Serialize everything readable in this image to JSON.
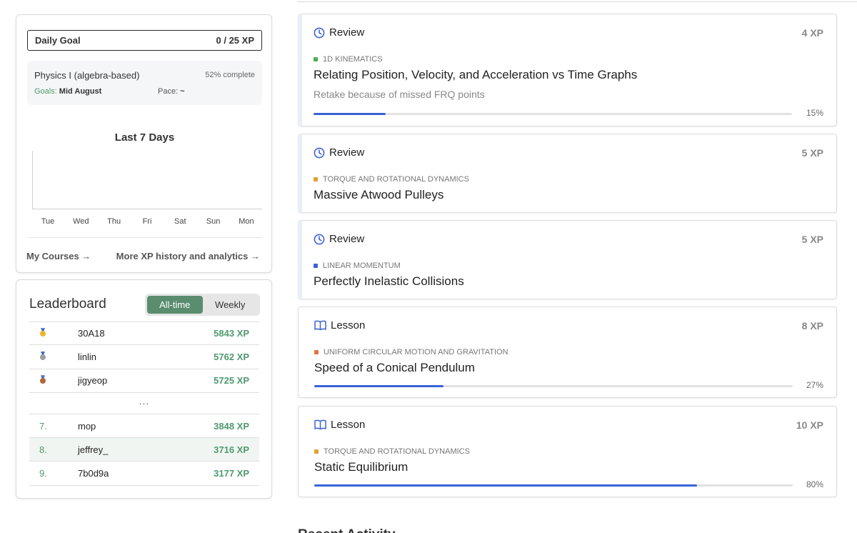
{
  "daily_goal": {
    "label": "Daily Goal",
    "value": "0 / 25 XP"
  },
  "course": {
    "name": "Physics I (algebra-based)",
    "progress_text": "52% complete",
    "goals_label": "Goals:",
    "goals_value": "Mid August",
    "pace_label": "Pace:",
    "pace_value": "~"
  },
  "chart_data": {
    "type": "bar",
    "title": "Last 7 Days",
    "categories": [
      "Tue",
      "Wed",
      "Thu",
      "Fri",
      "Sat",
      "Sun",
      "Mon"
    ],
    "values": [
      0,
      0,
      0,
      0,
      0,
      0,
      0
    ],
    "xlabel": "",
    "ylabel": "",
    "grid": false
  },
  "links": {
    "my_courses": "My Courses →",
    "xp_history": "More XP history and analytics →"
  },
  "leaderboard": {
    "title": "Leaderboard",
    "tabs": [
      "All-time",
      "Weekly"
    ],
    "active_tab": "All-time",
    "top": [
      {
        "medal": "gold",
        "name": "30A18",
        "xp": "5843 XP"
      },
      {
        "medal": "silver",
        "name": "linlin",
        "xp": "5762 XP"
      },
      {
        "medal": "bronze",
        "name": "jigyeop",
        "xp": "5725 XP"
      }
    ],
    "ellipsis": "...",
    "nearby": [
      {
        "rank": "7.",
        "name": "mop",
        "xp": "3848 XP"
      },
      {
        "rank": "8.",
        "name": "jeffrey_",
        "xp": "3716 XP"
      },
      {
        "rank": "9.",
        "name": "7b0d9a",
        "xp": "3177 XP"
      }
    ]
  },
  "tasks": [
    {
      "type": "Review",
      "icon": "clock-icon",
      "xp": "4 XP",
      "topic": "1D KINEMATICS",
      "topic_color": "#4caf50",
      "title": "Relating Position, Velocity, and Acceleration vs Time Graphs",
      "note": "Retake because of missed FRQ points",
      "progress": 0.15,
      "progress_text": "15%"
    },
    {
      "type": "Review",
      "icon": "clock-icon",
      "xp": "5 XP",
      "topic": "TORQUE AND ROTATIONAL DYNAMICS",
      "topic_color": "#e0a030",
      "title": "Massive Atwood Pulleys"
    },
    {
      "type": "Review",
      "icon": "clock-icon",
      "xp": "5 XP",
      "topic": "LINEAR MOMENTUM",
      "topic_color": "#3b63d7",
      "title": "Perfectly Inelastic Collisions"
    },
    {
      "type": "Lesson",
      "icon": "book-icon",
      "xp": "8 XP",
      "topic": "UNIFORM CIRCULAR MOTION AND GRAVITATION",
      "topic_color": "#e0763a",
      "title": "Speed of a Conical Pendulum",
      "progress": 0.27,
      "progress_text": "27%"
    },
    {
      "type": "Lesson",
      "icon": "book-icon",
      "xp": "10 XP",
      "topic": "TORQUE AND ROTATIONAL DYNAMICS",
      "topic_color": "#e0a030",
      "title": "Static Equilibrium",
      "progress": 0.8,
      "progress_text": "80%"
    }
  ],
  "recent_heading": "Recent Activity",
  "colors": {
    "accent": "#3b63d7",
    "green": "#4e9a6e",
    "active_tab": "#5a8c6e",
    "gold": "#f0b429",
    "silver": "#9aa0a6",
    "bronze": "#b0673a"
  }
}
